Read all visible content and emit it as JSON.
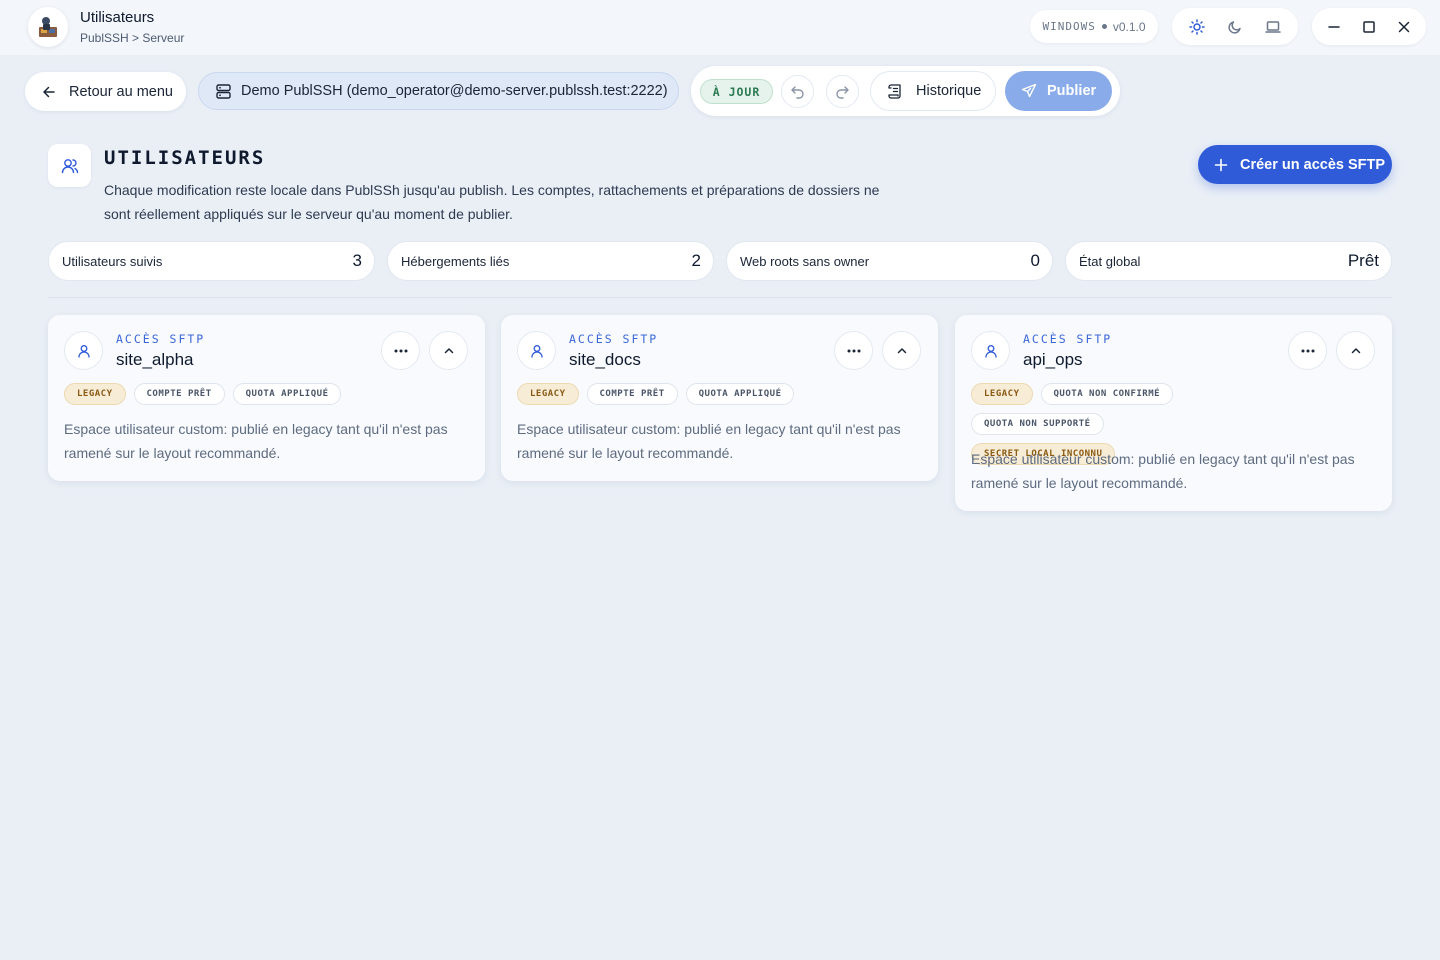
{
  "window": {
    "title": "Utilisateurs",
    "breadcrumb": "PublSSH > Serveur",
    "os_label": "WINDOWS",
    "version": "v0.1.0"
  },
  "toolbar": {
    "back_label": "Retour au menu",
    "server_label": "Demo PublSSH (demo_operator@demo-server.publssh.test:2222)",
    "status_label": "À JOUR",
    "history_label": "Historique",
    "publish_label": "Publier"
  },
  "section": {
    "title": "UTILISATEURS",
    "description": "Chaque modification reste locale dans PublSSh jusqu'au publish. Les comptes, rattachements et préparations de dossiers ne sont réellement appliqués sur le serveur qu'au moment de publier.",
    "create_label": "Créer un accès SFTP"
  },
  "stats": [
    {
      "label": "Utilisateurs suivis",
      "value": "3"
    },
    {
      "label": "Hébergements liés",
      "value": "2"
    },
    {
      "label": "Web roots sans owner",
      "value": "0"
    },
    {
      "label": "État global",
      "value": "Prêt"
    }
  ],
  "cards": [
    {
      "kicker": "ACCÈS SFTP",
      "name": "site_alpha",
      "tags": [
        {
          "label": "LEGACY",
          "tone": "warn"
        },
        {
          "label": "COMPTE PRÊT",
          "tone": "neutral"
        },
        {
          "label": "QUOTA APPLIQUÉ",
          "tone": "neutral"
        }
      ],
      "description": "Espace utilisateur custom: publié en legacy tant qu'il n'est pas ramené sur le layout recommandé."
    },
    {
      "kicker": "ACCÈS SFTP",
      "name": "site_docs",
      "tags": [
        {
          "label": "LEGACY",
          "tone": "warn"
        },
        {
          "label": "COMPTE PRÊT",
          "tone": "neutral"
        },
        {
          "label": "QUOTA APPLIQUÉ",
          "tone": "neutral"
        }
      ],
      "description": "Espace utilisateur custom: publié en legacy tant qu'il n'est pas ramené sur le layout recommandé."
    },
    {
      "kicker": "ACCÈS SFTP",
      "name": "api_ops",
      "tags": [
        {
          "label": "LEGACY",
          "tone": "warn"
        },
        {
          "label": "QUOTA NON CONFIRMÉ",
          "tone": "neutral"
        },
        {
          "label": "QUOTA NON SUPPORTÉ",
          "tone": "neutral"
        },
        {
          "label": "SECRET LOCAL INCONNU",
          "tone": "warn"
        }
      ],
      "description": "Espace utilisateur custom: publié en legacy tant qu'il n'est pas ramené sur le layout recommandé."
    }
  ],
  "icons": {
    "logo": "app-logo",
    "theme": [
      "sun-icon",
      "moon-icon",
      "laptop-icon"
    ],
    "window": [
      "minimize-icon",
      "maximize-icon",
      "close-icon"
    ]
  },
  "colors": {
    "accent": "#2f5bd9",
    "publish_disabled": "#8aabea",
    "status_ok": "#2b7a52",
    "tag_warn": "#8a5a14",
    "background": "#eaeff6"
  }
}
